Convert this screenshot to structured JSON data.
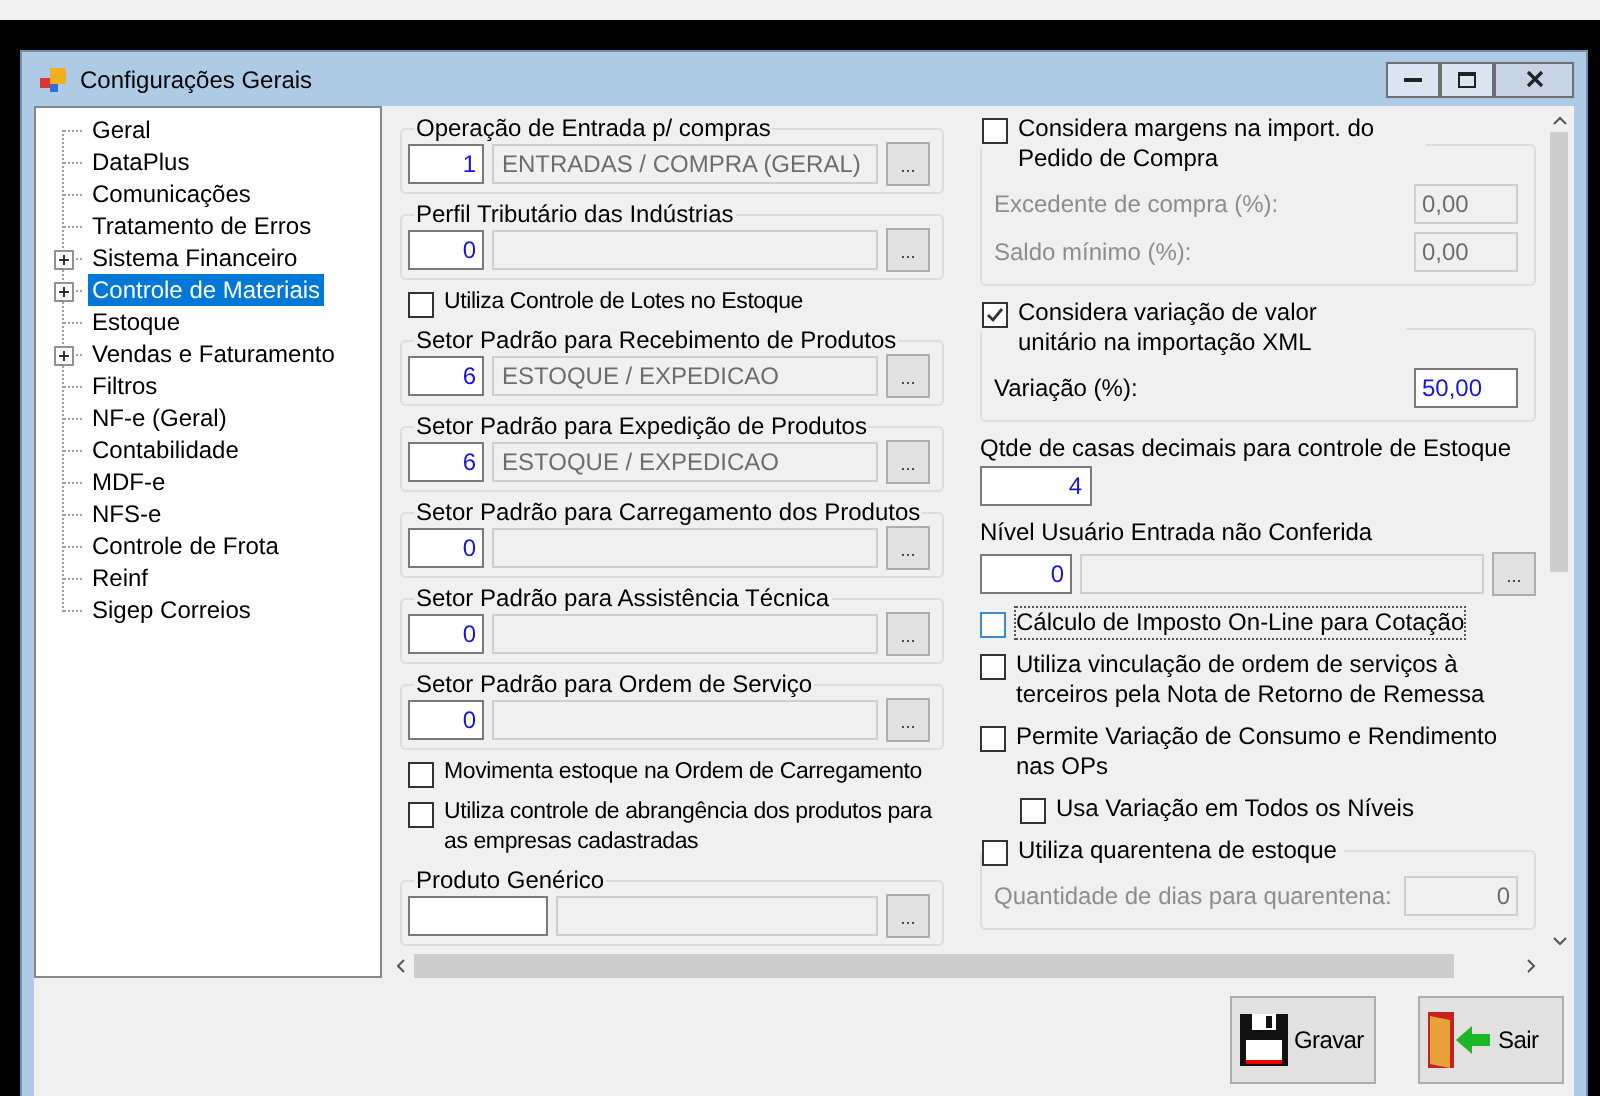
{
  "window": {
    "title": "Configurações Gerais"
  },
  "tree": {
    "items": [
      {
        "label": "Geral",
        "kind": "leaf",
        "selected": false
      },
      {
        "label": "DataPlus",
        "kind": "leaf",
        "selected": false
      },
      {
        "label": "Comunicações",
        "kind": "leaf",
        "selected": false
      },
      {
        "label": "Tratamento de Erros",
        "kind": "leaf",
        "selected": false
      },
      {
        "label": "Sistema Financeiro",
        "kind": "collapsed",
        "selected": false
      },
      {
        "label": "Controle de Materiais",
        "kind": "collapsed",
        "selected": true
      },
      {
        "label": "Estoque",
        "kind": "leaf",
        "selected": false
      },
      {
        "label": "Vendas e Faturamento",
        "kind": "collapsed",
        "selected": false
      },
      {
        "label": "Filtros",
        "kind": "leaf",
        "selected": false
      },
      {
        "label": "NF-e (Geral)",
        "kind": "leaf",
        "selected": false
      },
      {
        "label": "Contabilidade",
        "kind": "leaf",
        "selected": false
      },
      {
        "label": "MDF-e",
        "kind": "leaf",
        "selected": false
      },
      {
        "label": "NFS-e",
        "kind": "leaf",
        "selected": false
      },
      {
        "label": "Controle de Frota",
        "kind": "leaf",
        "selected": false
      },
      {
        "label": "Reinf",
        "kind": "leaf",
        "selected": false
      },
      {
        "label": "Sigep Correios",
        "kind": "leaf",
        "selected": false
      }
    ]
  },
  "left_panel": [
    {
      "kind": "lookup",
      "label": "Operação de Entrada p/ compras",
      "code": "1",
      "description": "ENTRADAS / COMPRA (GERAL)",
      "button": "..."
    },
    {
      "kind": "lookup",
      "label": "Perfil Tributário das Indústrias",
      "code": "0",
      "button": "..."
    },
    {
      "kind": "checkbox",
      "label": "Utiliza Controle de Lotes no Estoque",
      "checked": false
    },
    {
      "kind": "lookup",
      "label": "Setor Padrão para Recebimento de Produtos",
      "code": "6",
      "description": "ESTOQUE / EXPEDICAO",
      "button": "..."
    },
    {
      "kind": "lookup",
      "label": "Setor Padrão para Expedição de Produtos",
      "code": "6",
      "description": "ESTOQUE / EXPEDICAO",
      "button": "..."
    },
    {
      "kind": "lookup",
      "label": "Setor Padrão para Carregamento dos Produtos",
      "code": "0",
      "button": "..."
    },
    {
      "kind": "lookup",
      "label": "Setor Padrão para Assistência Técnica",
      "code": "0",
      "button": "..."
    },
    {
      "kind": "lookup",
      "label": "Setor Padrão para Ordem de Serviço",
      "code": "0",
      "button": "..."
    },
    {
      "kind": "checkbox",
      "label": "Movimenta estoque na Ordem de Carregamento",
      "checked": false
    },
    {
      "kind": "checkbox",
      "label": "Utiliza controle de abrangência dos produtos para as empresas cadastradas",
      "checked": false
    },
    {
      "kind": "wide_lookup",
      "label": "Produto Genérico",
      "button": "..."
    }
  ],
  "right_panel": [
    {
      "kind": "checkgroup",
      "label": "Considera margens na import. do Pedido de Compra",
      "checked": false,
      "focused": false,
      "fields": [
        {
          "label": "Excedente de compra (%):",
          "value": "0,00"
        },
        {
          "label": "Saldo mínimo (%):",
          "value": "0,00"
        }
      ]
    },
    {
      "kind": "checkgroup",
      "label": "Considera variação de valor unitário na importação XML",
      "checked": true,
      "focused": false,
      "fields": [
        {
          "label": "Variação (%):",
          "value": "50,00"
        }
      ]
    },
    {
      "kind": "number",
      "label": "Qtde de casas decimais para controle de Estoque",
      "value": "4"
    },
    {
      "kind": "lookup",
      "label": "Nível Usuário Entrada não Conferida",
      "code": "0",
      "button": "..."
    },
    {
      "kind": "checkbox",
      "label": "Cálculo de Imposto On-Line para Cotação",
      "checked": false,
      "focused": true
    },
    {
      "kind": "checkbox",
      "label": "Utiliza vinculação de ordem de serviços à terceiros pela Nota de Retorno de Remessa",
      "checked": false,
      "focused": false
    },
    {
      "kind": "checkbox",
      "label": "Permite Variação de Consumo e Rendimento nas OPs",
      "checked": false,
      "focused": false,
      "children": [
        {
          "kind": "checkbox",
          "label": "Usa Variação em Todos os Níveis",
          "checked": false,
          "focused": false
        }
      ]
    },
    {
      "kind": "checkgroup",
      "label": "Utiliza quarentena de estoque",
      "checked": false,
      "focused": false,
      "fields": [
        {
          "label": "Quantidade de dias para quarentena:",
          "value": "0"
        }
      ]
    }
  ],
  "buttons": [
    {
      "label": "Gravar",
      "kind": "save"
    },
    {
      "label": "Sair",
      "kind": "exit"
    }
  ]
}
